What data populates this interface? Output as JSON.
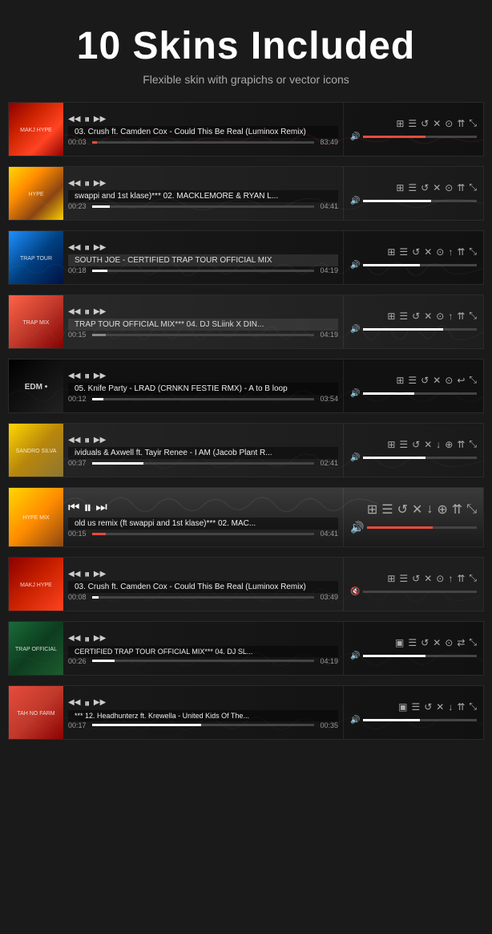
{
  "header": {
    "title": "10 Skins Included",
    "subtitle": "Flexible skin with grapichs or vector icons"
  },
  "players": [
    {
      "id": "player1",
      "skin": "skin-dark",
      "art_class": "art-1",
      "art_text": "MAKJ\nHYPE",
      "track": "03. Crush ft. Camden Cox - Could This Be Real (Luminox Remix)",
      "time_current": "00:03",
      "time_total": "83:49",
      "progress_pct": 2,
      "volume_pct": 55,
      "progress_color": "prog-red",
      "volume_color": "vol-red"
    },
    {
      "id": "player2",
      "skin": "skin-medium",
      "art_class": "art-2",
      "art_text": "HYPE",
      "track": "swappi and 1st klase)*** 02. MACKLEMORE & RYAN L...",
      "time_current": "00:23",
      "time_total": "04:41",
      "progress_pct": 8,
      "volume_pct": 60,
      "progress_color": "prog-white",
      "volume_color": "vol-white"
    },
    {
      "id": "player3",
      "skin": "skin-dark",
      "art_class": "art-3",
      "art_text": "TRAP\nTOUR",
      "track": "SOUTH JOE - CERTIFIED TRAP TOUR OFFICIAL MIX",
      "time_current": "00:18",
      "time_total": "04:19",
      "progress_pct": 7,
      "volume_pct": 50,
      "progress_color": "prog-white",
      "volume_color": "vol-white"
    },
    {
      "id": "player4",
      "skin": "skin-light-dark",
      "art_class": "art-4",
      "art_text": "TRAP\nMIX",
      "track": "TRAP TOUR OFFICIAL MIX*** 04. DJ SLiink X DIN...",
      "time_current": "00:15",
      "time_total": "04:19",
      "progress_pct": 6,
      "volume_pct": 70,
      "progress_color": "prog-gray",
      "volume_color": "vol-white"
    },
    {
      "id": "player5",
      "skin": "skin-dark",
      "art_class": "art-5",
      "art_text": "EDM\n•",
      "track": "05. Knife Party - LRAD (CRNKN FESTIE RMX) - A to B loop",
      "time_current": "00:12",
      "time_total": "03:54",
      "progress_pct": 5,
      "volume_pct": 45,
      "progress_color": "prog-white",
      "volume_color": "vol-white"
    },
    {
      "id": "player6",
      "skin": "skin-medium",
      "art_class": "art-6",
      "art_text": "SANDRO\nSILVA",
      "track": "ividuals & Axwell ft. Tayir Renee - I AM (Jacob Plant R...",
      "time_current": "00:37",
      "time_total": "02:41",
      "progress_pct": 23,
      "volume_pct": 55,
      "progress_color": "prog-white",
      "volume_color": "vol-white"
    },
    {
      "id": "player7",
      "skin": "skin-gray-gradient",
      "art_class": "art-7",
      "art_text": "HYPE\nMIX",
      "track": "old us remix (ft swappi and 1st klase)*** 02. MAC...",
      "time_current": "00:15",
      "time_total": "04:41",
      "progress_pct": 6,
      "volume_pct": 60,
      "progress_color": "prog-red",
      "volume_color": "vol-red",
      "large_icons": true
    },
    {
      "id": "player8",
      "skin": "skin-charcoal",
      "art_class": "art-8",
      "art_text": "MAKJ\nHYPE",
      "track": "03. Crush ft. Camden Cox - Could This Be Real (Luminox Remix)",
      "time_current": "00:08",
      "time_total": "03:49",
      "progress_pct": 3,
      "volume_pct": 0,
      "progress_color": "prog-white",
      "volume_color": "vol-white",
      "muted": true
    },
    {
      "id": "player9",
      "skin": "skin-dark",
      "art_class": "art-9",
      "art_text": "TRAP\nOFFICIAL",
      "track": "CERTIFIED TRAP TOUR OFFICIAL MIX*** 04. DJ SL...",
      "time_current": "00:26",
      "time_total": "04:19",
      "progress_pct": 10,
      "volume_pct": 55,
      "progress_color": "prog-white",
      "volume_color": "vol-white",
      "minimal": true
    },
    {
      "id": "player10",
      "skin": "skin-dark",
      "art_class": "art-10",
      "art_text": "TAH\nNO\nFARM",
      "track": "*** 12. Headhunterz ft. Krewella - United Kids Of The...",
      "time_current": "00:17",
      "time_total": "00:35",
      "progress_pct": 49,
      "volume_pct": 50,
      "progress_color": "prog-white",
      "volume_color": "vol-white",
      "minimal": true
    }
  ],
  "icons": {
    "prev": "⏮",
    "play": "▶",
    "pause": "⏸",
    "next": "⏭",
    "rewind": "⏪",
    "ff": "⏩",
    "list": "☰",
    "shuffle": "⇄",
    "repeat": "↺",
    "close": "✕",
    "download": "↓",
    "upload": "↑",
    "share": "⇈",
    "expand": "⤡",
    "volume": "🔊"
  }
}
